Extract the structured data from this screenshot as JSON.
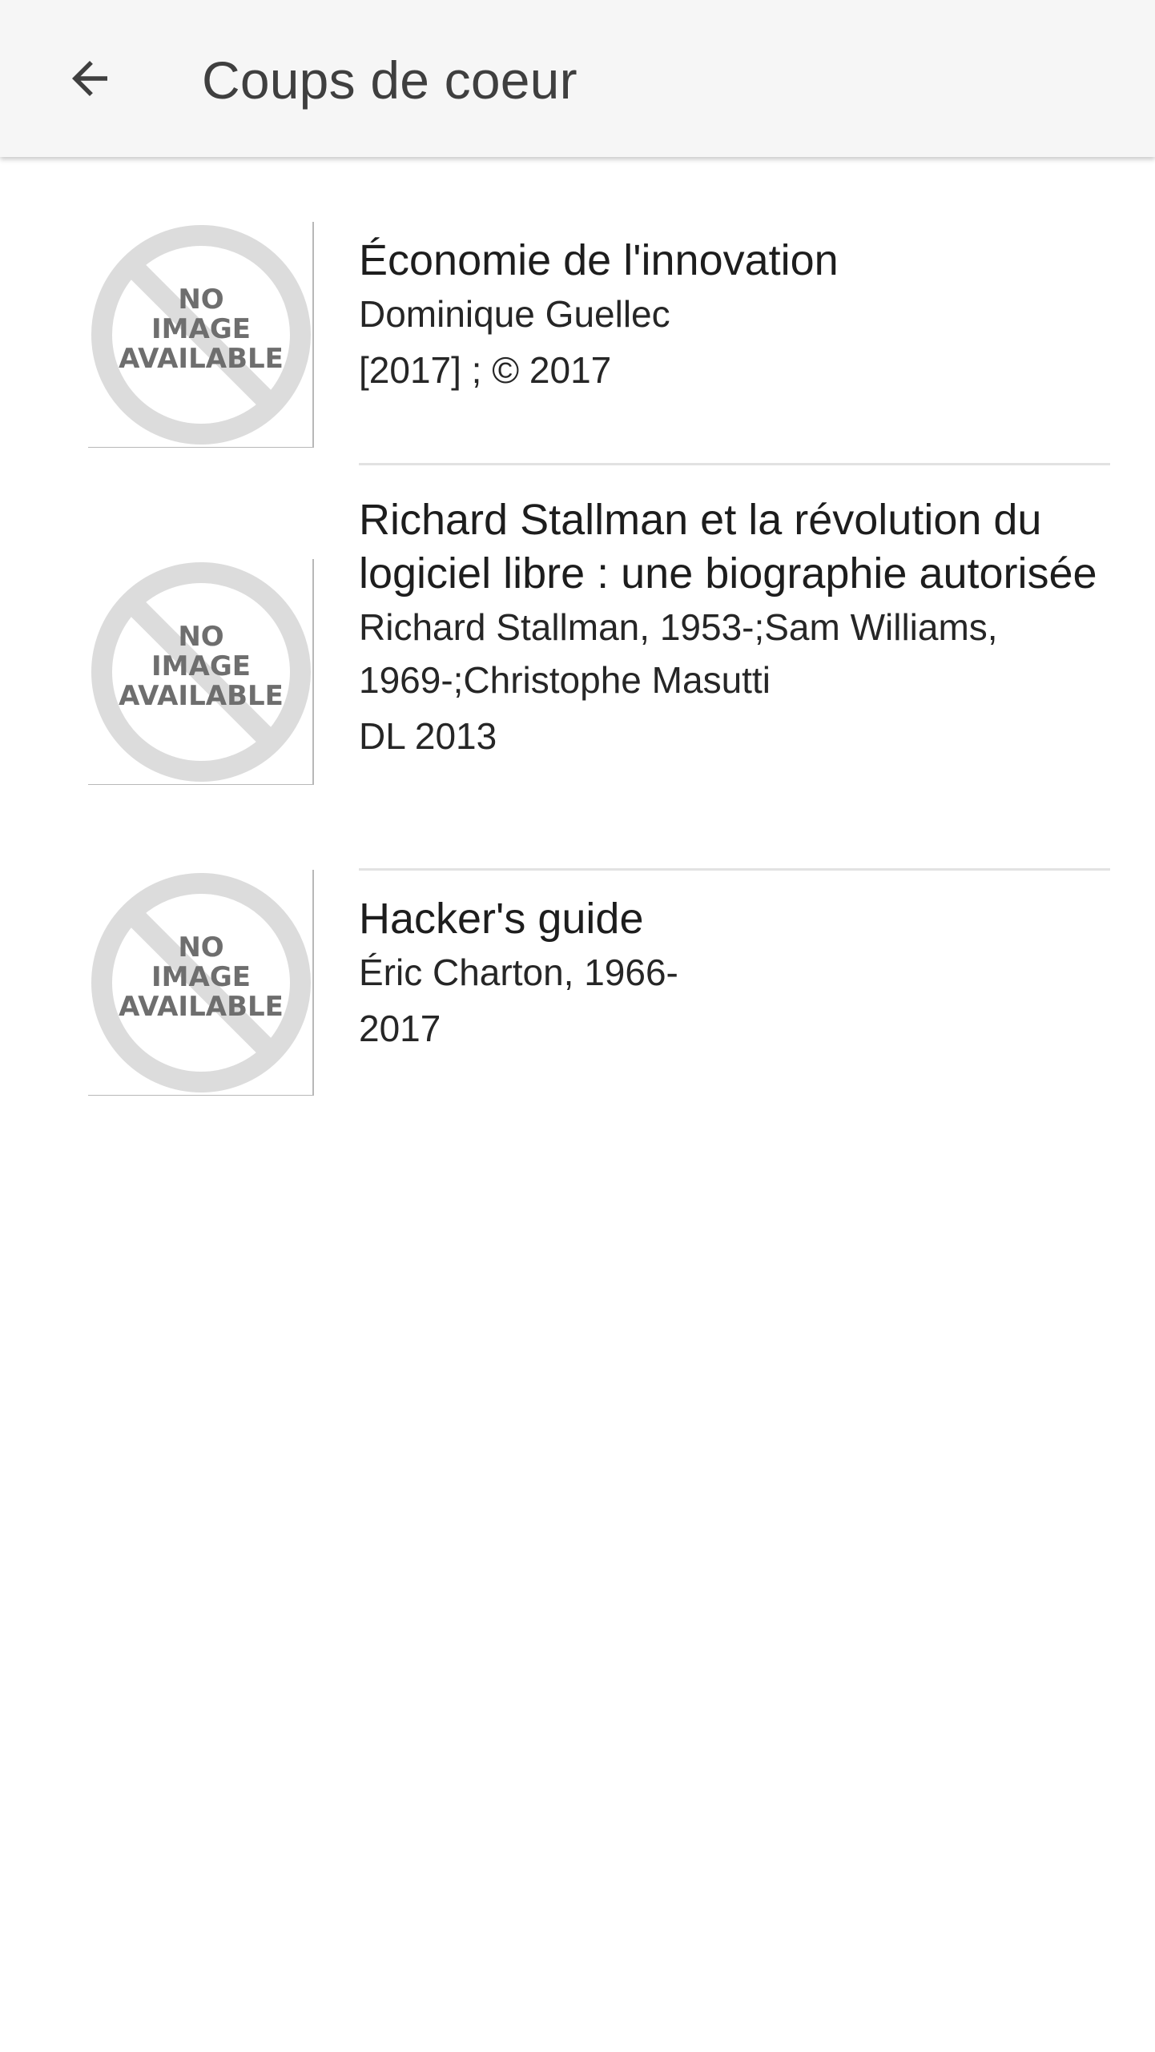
{
  "appbar": {
    "title": "Coups de coeur",
    "back_icon": "arrow-back-icon"
  },
  "placeholder": {
    "line1": "NO",
    "line2": "IMAGE",
    "line3": "AVAILABLE"
  },
  "items": [
    {
      "title": "Économie de l'innovation",
      "author": "Dominique Guellec",
      "date": "[2017] ; © 2017"
    },
    {
      "title": "Richard Stallman et la révolution du logiciel libre : une biographie autorisée",
      "author": "Richard Stallman, 1953-;Sam Williams, 1969-;Christophe Masutti",
      "date": "DL 2013"
    },
    {
      "title": "Hacker's guide",
      "author": "Éric Charton, 1966-",
      "date": "2017"
    }
  ],
  "colors": {
    "appbar_bg": "#f6f6f6",
    "divider": "#e2e2e2",
    "placeholder_gray": "#dcdcdc",
    "placeholder_text": "#6e6e6e"
  }
}
